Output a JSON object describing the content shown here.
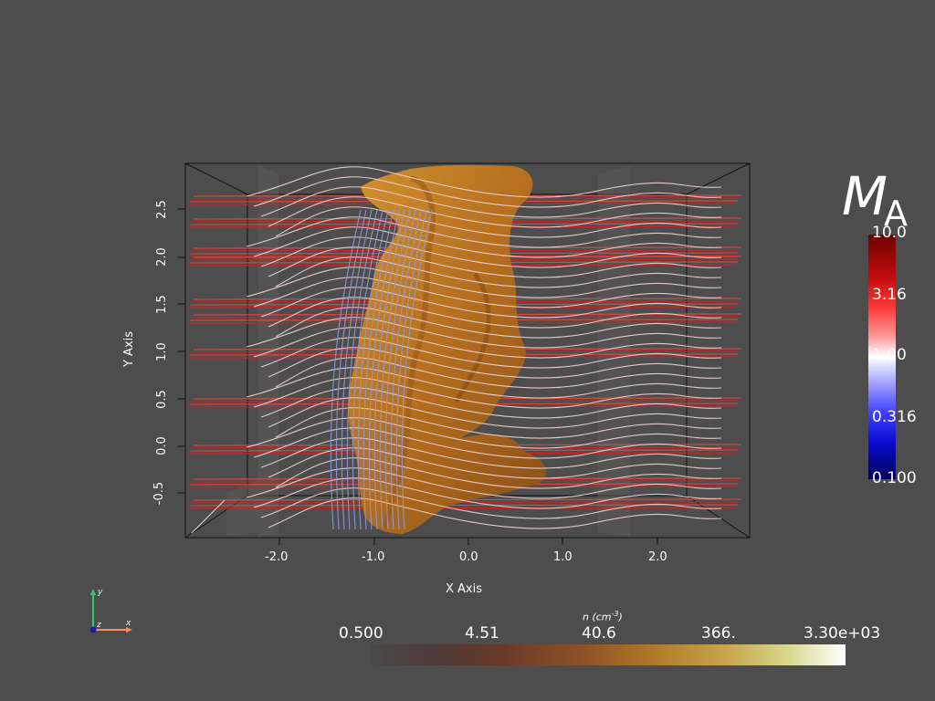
{
  "axes": {
    "x_title": "X Axis",
    "y_title": "Y Axis",
    "x_ticks": [
      "-2.0",
      "-1.0",
      "0.0",
      "1.0",
      "2.0"
    ],
    "y_ticks": [
      "2.5",
      "2.0",
      "1.5",
      "1.0",
      "0.5",
      "0.0",
      "-0.5"
    ]
  },
  "colorbar_ma": {
    "title_main": "M",
    "title_sub": "A",
    "labels": [
      "10.0",
      "3.16",
      "1.00",
      "0.316",
      "0.100"
    ]
  },
  "colorbar_n": {
    "title": "n (cm",
    "title_exp": "-3",
    "title_close": ")",
    "labels": [
      "0.500",
      "4.51",
      "40.6",
      "366.",
      "3.30e+03"
    ]
  },
  "orientation": {
    "y": "y",
    "z": "z",
    "x": "x"
  },
  "colors": {
    "background": "#4d4d4d",
    "density_surface": "#b8741f",
    "streamline_high": "#d42020",
    "streamline_mid": "#f2d6d6",
    "streamline_low": "#8f9ad8"
  }
}
